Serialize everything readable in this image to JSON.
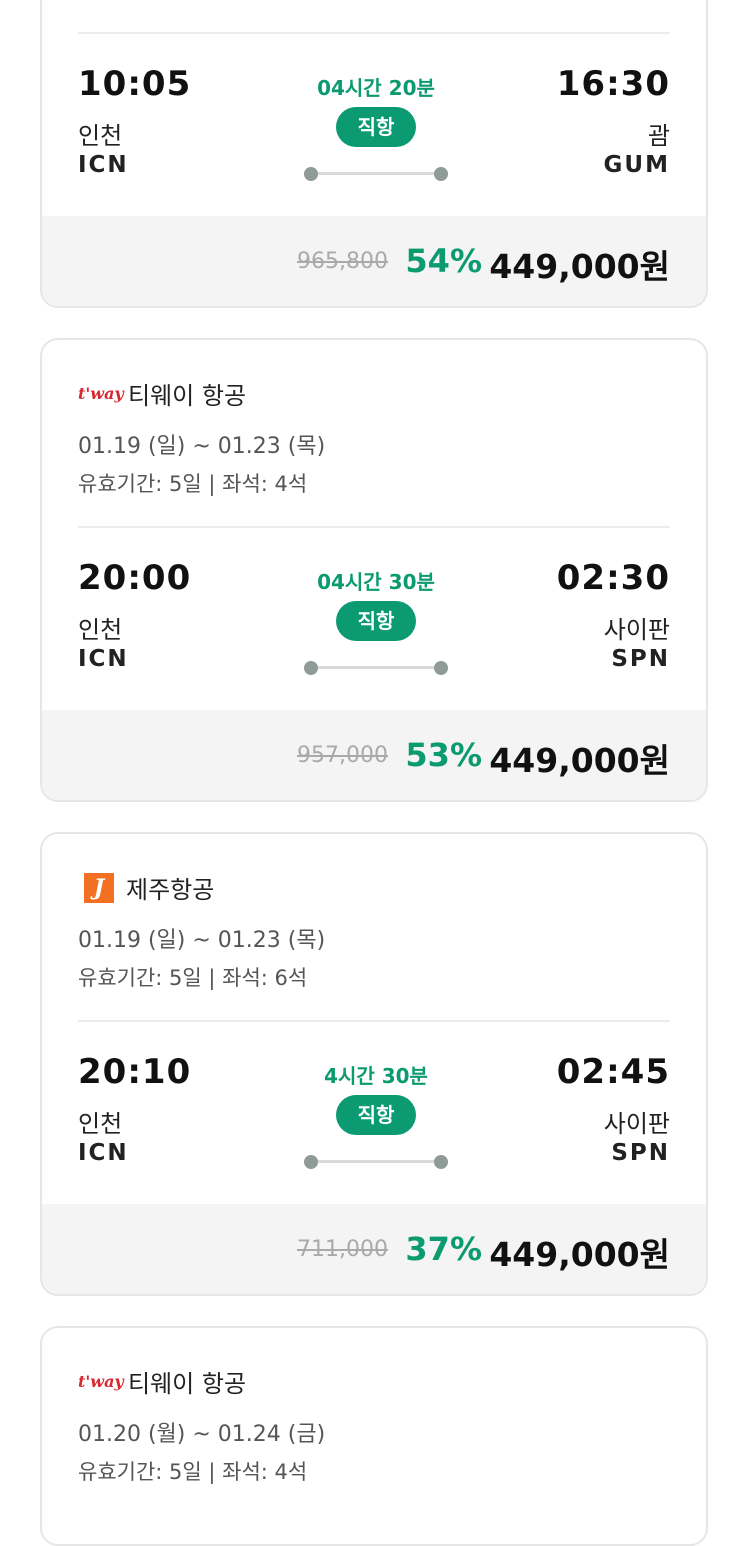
{
  "cards": [
    {
      "dep_time": "10:05",
      "dep_city": "인천",
      "dep_code": "ICN",
      "duration": "04시간 20분",
      "badge": "직항",
      "arr_time": "16:30",
      "arr_city": "괌",
      "arr_code": "GUM",
      "original_price": "965,800",
      "discount": "54%",
      "price": "449,000원"
    },
    {
      "airline": "티웨이 항공",
      "airline_logo": "t'way",
      "dates": "01.19 (일) ~ 01.23 (목)",
      "validity": "유효기간: 5일 | 좌석: 4석",
      "dep_time": "20:00",
      "dep_city": "인천",
      "dep_code": "ICN",
      "duration": "04시간 30분",
      "badge": "직항",
      "arr_time": "02:30",
      "arr_city": "사이판",
      "arr_code": "SPN",
      "original_price": "957,000",
      "discount": "53%",
      "price": "449,000원"
    },
    {
      "airline": "제주항공",
      "airline_logo": "J",
      "dates": "01.19 (일) ~ 01.23 (목)",
      "validity": "유효기간: 5일 | 좌석: 6석",
      "dep_time": "20:10",
      "dep_city": "인천",
      "dep_code": "ICN",
      "duration": "4시간 30분",
      "badge": "직항",
      "arr_time": "02:45",
      "arr_city": "사이판",
      "arr_code": "SPN",
      "original_price": "711,000",
      "discount": "37%",
      "price": "449,000원"
    },
    {
      "airline": "티웨이 항공",
      "airline_logo": "t'way",
      "dates": "01.20 (월) ~ 01.24 (금)",
      "validity": "유효기간: 5일 | 좌석: 4석"
    }
  ],
  "colors": {
    "accent": "#0c9a6f",
    "tway_red": "#d7282f",
    "jeju_orange": "#f36f21"
  }
}
